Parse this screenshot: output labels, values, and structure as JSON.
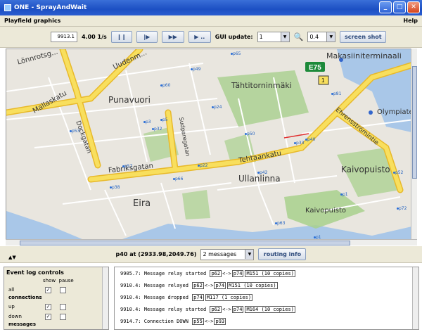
{
  "window": {
    "title": "ONE - SprayAndWait"
  },
  "menubar": {
    "left": "Playfield graphics",
    "right": "Help"
  },
  "toolbar": {
    "sim_time": "9913.1",
    "speed": "4.00 1/s",
    "pause_icon": "pause-icon",
    "step_icon": "step-icon",
    "ffw_icon": "fast-forward-icon",
    "play_until_icon": "play-until-icon",
    "gui_update_label": "GUI update:",
    "gui_update_value": "1",
    "zoom_value": "0.4",
    "screenshot_label": "screen shot"
  },
  "map": {
    "streets": [
      "Lönnrotsg...",
      "Uudenm...",
      "Mallaskatu",
      "Punavuori",
      "Tähtitorninmäki",
      "Makasiiniterminaali",
      "E75",
      "Olympiater...",
      "Dockgatan",
      "Fabriksgatan",
      "Tehtaankatu",
      "Ullanlinna",
      "Eira",
      "Kaivopuisto",
      "Kaivopuisto",
      "Ehrensströmintie",
      "Sudparegatan"
    ],
    "nodes": [
      "p65",
      "p49",
      "p60",
      "p24",
      "p81",
      "p3",
      "p5",
      "p32",
      "p33",
      "p53",
      "p50",
      "p40",
      "p57",
      "p22",
      "p42",
      "p38",
      "p66",
      "p1",
      "p72",
      "p63",
      "p52",
      "p1"
    ]
  },
  "status": {
    "coord": "p40 at (2933.98,2049.76)",
    "messages_value": "2 messages",
    "routing_button": "routing info"
  },
  "event_log_controls": {
    "title": "Event log controls",
    "col_show": "show",
    "col_pause": "pause",
    "rows": [
      {
        "label": "all",
        "show": true,
        "pause": false
      },
      {
        "section": "connections"
      },
      {
        "label": "up",
        "show": true,
        "pause": false
      },
      {
        "label": "down",
        "show": true,
        "pause": false
      },
      {
        "section": "messages"
      }
    ]
  },
  "log": [
    {
      "t": "9905.7:",
      "text": "Message relay started",
      "a": "p62",
      "b": "p74",
      "msg": "M151 (10 copies)"
    },
    {
      "t": "9910.4:",
      "text": "Message relayed",
      "a": "p62",
      "b": "p74",
      "msg": "M151 (10 copies)"
    },
    {
      "t": "9910.4:",
      "text": "Message dropped",
      "a": "p74",
      "b": "",
      "msg": "M117 (1 copies)"
    },
    {
      "t": "9910.4:",
      "text": "Message relay started",
      "a": "p62",
      "b": "p74",
      "msg": "M164 (10 copies)"
    },
    {
      "t": "9914.7:",
      "text": "Connection DOWN",
      "a": "p55",
      "b": "p93",
      "msg": ""
    }
  ],
  "colors": {
    "road": "#f5d64c",
    "park": "#a8d08d",
    "water": "#a9c7e8",
    "titlebar": "#2a5dd0"
  }
}
